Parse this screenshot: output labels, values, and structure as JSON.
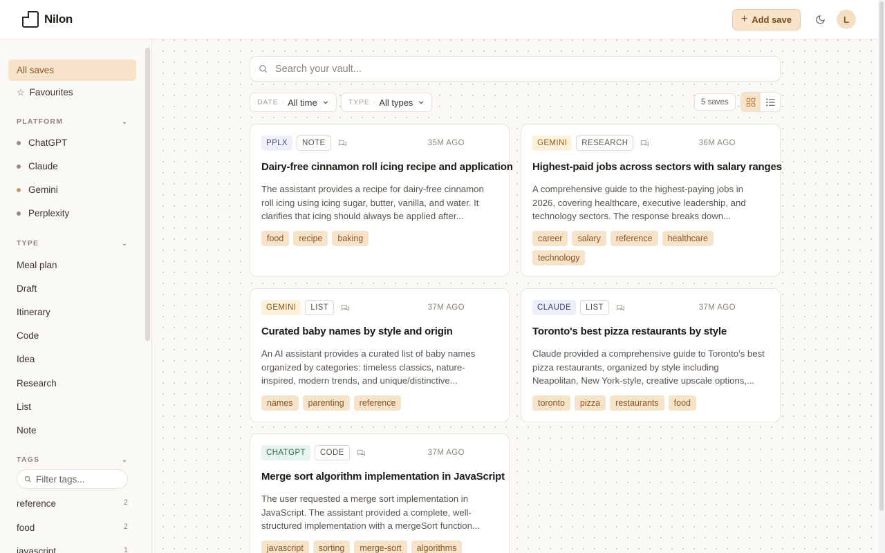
{
  "app": {
    "name": "Nilon"
  },
  "header": {
    "add_save_label": "Add save",
    "avatar_initial": "L"
  },
  "sidebar": {
    "all_saves": "All saves",
    "favourites": "Favourites",
    "platform_heading": "PLATFORM",
    "platforms": [
      {
        "label": "ChatGPT",
        "color": "#8e8a85"
      },
      {
        "label": "Claude",
        "color": "#8e8a85"
      },
      {
        "label": "Gemini",
        "color": "#c49a6c"
      },
      {
        "label": "Perplexity",
        "color": "#8e8a85"
      }
    ],
    "type_heading": "TYPE",
    "types": [
      "Meal plan",
      "Draft",
      "Itinerary",
      "Code",
      "Idea",
      "Research",
      "List",
      "Note"
    ],
    "tags_heading": "TAGS",
    "tag_filter_placeholder": "Filter tags...",
    "tags": [
      {
        "label": "reference",
        "count": "2"
      },
      {
        "label": "food",
        "count": "2"
      },
      {
        "label": "javascript",
        "count": "1"
      }
    ]
  },
  "main": {
    "search_placeholder": "Search your vault...",
    "date_filter": {
      "label": "DATE",
      "value": "All time"
    },
    "type_filter": {
      "label": "TYPE",
      "value": "All types"
    },
    "saves_count": "5 saves",
    "cards": [
      {
        "platform": "PPLX",
        "platform_bg": "#eef0fa",
        "platform_color": "#4a4f78",
        "type": "NOTE",
        "time": "35M AGO",
        "title": "Dairy-free cinnamon roll icing recipe and application",
        "description": "The assistant provides a recipe for dairy-free cinnamon roll icing using icing sugar, butter, vanilla, and water. It clarifies that icing should always be applied after...",
        "tags": [
          "food",
          "recipe",
          "baking"
        ]
      },
      {
        "platform": "GEMINI",
        "platform_bg": "#fbf1dd",
        "platform_color": "#8a5a14",
        "type": "RESEARCH",
        "time": "36M AGO",
        "title": "Highest-paid jobs across sectors with salary ranges",
        "description": "A comprehensive guide to the highest-paying jobs in 2026, covering healthcare, executive leadership, and technology sectors. The response breaks down...",
        "tags": [
          "career",
          "salary",
          "reference",
          "healthcare",
          "technology"
        ]
      },
      {
        "platform": "GEMINI",
        "platform_bg": "#fbf1dd",
        "platform_color": "#8a5a14",
        "type": "LIST",
        "time": "37M AGO",
        "title": "Curated baby names by style and origin",
        "description": "An AI assistant provides a curated list of baby names organized by categories: timeless classics, nature-inspired, modern trends, and unique/distinctive...",
        "tags": [
          "names",
          "parenting",
          "reference"
        ]
      },
      {
        "platform": "CLAUDE",
        "platform_bg": "#eceefa",
        "platform_color": "#3d4478",
        "type": "LIST",
        "time": "37M AGO",
        "title": "Toronto's best pizza restaurants by style",
        "description": "Claude provided a comprehensive guide to Toronto's best pizza restaurants, organized by style including Neapolitan, New York-style, creative upscale options,...",
        "tags": [
          "toronto",
          "pizza",
          "restaurants",
          "food"
        ]
      },
      {
        "platform": "CHATGPT",
        "platform_bg": "#e6f4ee",
        "platform_color": "#2f6b52",
        "type": "CODE",
        "time": "37M AGO",
        "title": "Merge sort algorithm implementation in JavaScript",
        "description": "The user requested a merge sort implementation in JavaScript. The assistant provided a complete, well-structured implementation with a mergeSort function...",
        "tags": [
          "javascript",
          "sorting",
          "merge-sort",
          "algorithms"
        ]
      }
    ]
  }
}
